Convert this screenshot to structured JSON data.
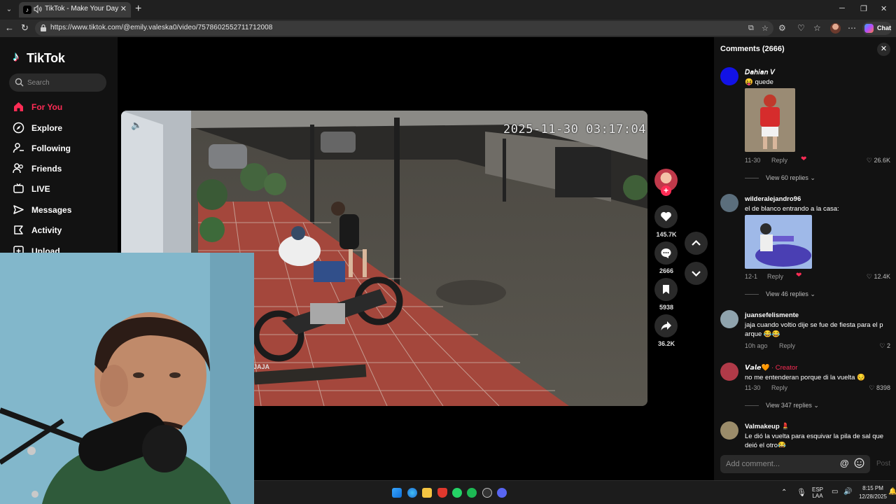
{
  "browser": {
    "tab_title": "TikTok - Make Your Day",
    "url": "https://www.tiktok.com/@emily.valeska0/video/7578602552711712008",
    "copilot_label": "Chat"
  },
  "tiktok": {
    "logo_text": "TikTok",
    "search_placeholder": "Search",
    "nav": [
      {
        "label": "For You",
        "icon": "home-icon",
        "active": true
      },
      {
        "label": "Explore",
        "icon": "compass-icon"
      },
      {
        "label": "Following",
        "icon": "following-icon"
      },
      {
        "label": "Friends",
        "icon": "friends-icon"
      },
      {
        "label": "LIVE",
        "icon": "live-icon"
      },
      {
        "label": "Messages",
        "icon": "messages-icon"
      },
      {
        "label": "Activity",
        "icon": "activity-icon"
      },
      {
        "label": "Upload",
        "icon": "upload-icon"
      }
    ],
    "video": {
      "timestamp_overlay": "2025-11-30 03:17:04",
      "caption_fragment": "JAJA"
    },
    "actions": {
      "likes": "145.7K",
      "comments": "2666",
      "saves": "5938",
      "shares": "36.2K"
    }
  },
  "comments": {
    "header": "Comments (2666)",
    "input_placeholder": "Add comment...",
    "post_label": "Post",
    "items": [
      {
        "user": "𝘋𝘢𝘩𝘪𝘢𝘯 𝘝",
        "text": "😝 quede",
        "date": "11-30",
        "reply": "Reply",
        "likes": "26.6K",
        "view_replies": "View 60 replies"
      },
      {
        "user": "wilderalejandro96",
        "text": "el de blanco entrando a la casa:",
        "date": "12-1",
        "reply": "Reply",
        "likes": "12.4K",
        "view_replies": "View 46 replies"
      },
      {
        "user": "juansefelismente",
        "text": "jaja cuando voltio dije se fue de fiesta para el p arque 😂😂",
        "date": "10h ago",
        "reply": "Reply",
        "likes": "2"
      },
      {
        "user": "𝙑𝙖𝙡𝙚🧡",
        "creator_badge": "· Creator",
        "text": "no me entenderan porque di la vuelta 😔",
        "date": "11-30",
        "reply": "Reply",
        "likes": "8398",
        "view_replies": "View 347 replies"
      },
      {
        "user": "Valmakeup 💄",
        "text": "Le dió la vuelta para esquivar la pila de sal que dejó el otro😂"
      }
    ]
  },
  "taskbar": {
    "lang_top": "ESP",
    "lang_bottom": "LAA",
    "time": "8:15 PM",
    "date": "12/28/2025"
  }
}
